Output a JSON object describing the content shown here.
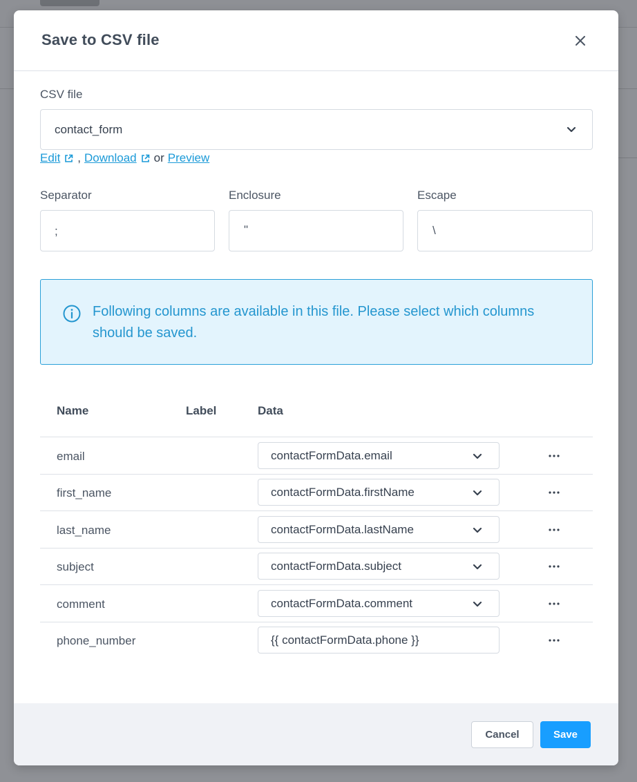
{
  "dialog": {
    "title": "Save to CSV file"
  },
  "csv_file": {
    "label": "CSV file",
    "value": "contact_form"
  },
  "links": {
    "edit": "Edit",
    "comma": ",",
    "download": "Download",
    "or": "or",
    "preview": "Preview"
  },
  "separator": {
    "label": "Separator",
    "value": ";"
  },
  "enclosure": {
    "label": "Enclosure",
    "value": "\""
  },
  "escape": {
    "label": "Escape",
    "value": "\\"
  },
  "info": {
    "message": "Following columns are available in this file. Please select which columns should be saved."
  },
  "table": {
    "headers": {
      "name": "Name",
      "label": "Label",
      "data": "Data"
    },
    "rows": [
      {
        "name": "email",
        "data": "contactFormData.email",
        "type": "select"
      },
      {
        "name": "first_name",
        "data": "contactFormData.firstName",
        "type": "select"
      },
      {
        "name": "last_name",
        "data": "contactFormData.lastName",
        "type": "select"
      },
      {
        "name": "subject",
        "data": "contactFormData.subject",
        "type": "select"
      },
      {
        "name": "comment",
        "data": "contactFormData.comment",
        "type": "select"
      },
      {
        "name": "phone_number",
        "data": "{{ contactFormData.phone }}",
        "type": "input"
      }
    ]
  },
  "footer": {
    "cancel_label": "Cancel",
    "save_label": "Save"
  },
  "colors": {
    "accent": "#189eff",
    "link": "#1b9ad8",
    "info_bg": "#e3f4fd",
    "info_border": "#2a9fd8"
  }
}
